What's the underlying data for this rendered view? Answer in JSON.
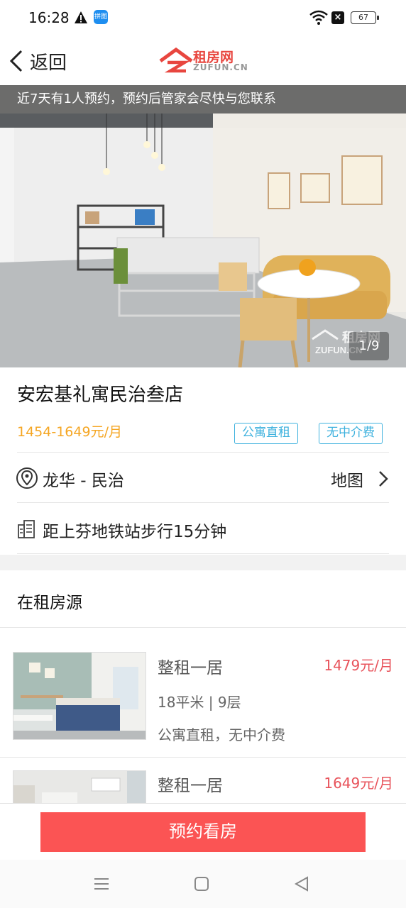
{
  "status_bar": {
    "time": "16:28",
    "app_badge": "拼图",
    "battery": "67",
    "icons": [
      "warning-icon",
      "app-badge-icon",
      "wifi-icon",
      "no-sim-icon",
      "battery-icon"
    ]
  },
  "nav": {
    "back_label": "返回",
    "logo_cn": "租房网",
    "logo_en": "ZUFUN.CN"
  },
  "hero": {
    "notice": "近7天有1人预约，预约后管家会尽快与您联系",
    "counter": "1/9",
    "watermark_cn": "租房网",
    "watermark_en": "ZUFUN.CN"
  },
  "property": {
    "title": "安宏基礼寓民治叁店",
    "price": "1454-1649元/月",
    "tags": [
      "公寓直租",
      "无中介费"
    ],
    "location": "龙华 - 民治",
    "map_label": "地图",
    "metro": "距上芬地铁站步行15分钟"
  },
  "section": {
    "title": "在租房源"
  },
  "listings": [
    {
      "title": "整租一居",
      "price": "1479元/月",
      "size": "18平米 | 9层",
      "features": "公寓直租，无中介费"
    },
    {
      "title": "整租一居",
      "price": "1649元/月"
    }
  ],
  "footer": {
    "book_label": "预约看房"
  },
  "colors": {
    "price_orange": "#f5a623",
    "tag_blue": "#3fb2de",
    "listing_price_red": "#e8535b",
    "button_red": "#fb5454"
  }
}
